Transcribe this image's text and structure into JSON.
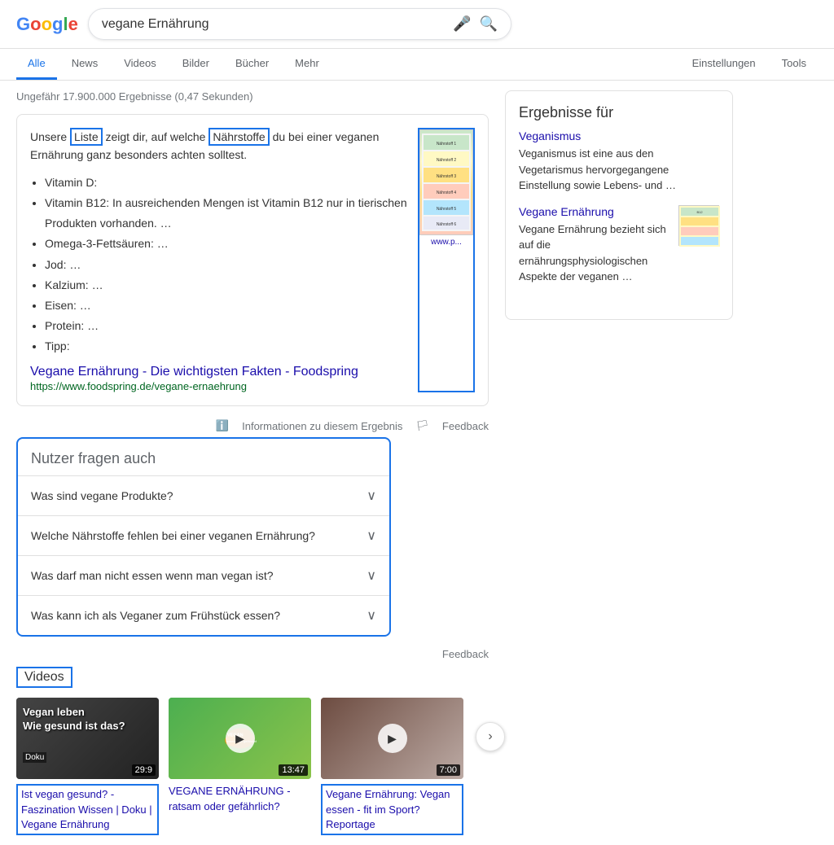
{
  "header": {
    "logo_letters": [
      "G",
      "o",
      "o",
      "g",
      "l",
      "e"
    ],
    "search_query": "vegane Ernährung",
    "mic_icon": "🎤",
    "search_icon": "🔍"
  },
  "nav": {
    "tabs": [
      {
        "label": "Alle",
        "active": true
      },
      {
        "label": "News",
        "active": false
      },
      {
        "label": "Videos",
        "active": false
      },
      {
        "label": "Bilder",
        "active": false
      },
      {
        "label": "Bücher",
        "active": false
      },
      {
        "label": "Mehr",
        "active": false
      }
    ],
    "right_tabs": [
      {
        "label": "Einstellungen"
      },
      {
        "label": "Tools"
      }
    ]
  },
  "results_count": "Ungefähr 17.900.000 Ergebnisse (0,47 Sekunden)",
  "featured_snippet": {
    "text_before": "Unsere ",
    "highlight1": "Liste",
    "text_middle": " zeigt dir, auf welche ",
    "highlight2": "Nährstoffe",
    "text_after": " du bei einer veganen Ernährung ganz besonders achten solltest.",
    "list_items": [
      "Vitamin D:",
      "Vitamin B12: In ausreichenden Mengen ist Vitamin B12 nur in tierischen Produkten vorhanden. …",
      "Omega-3-Fettsäuren: …",
      "Jod: …",
      "Kalzium: …",
      "Eisen: …",
      "Protein: …",
      "Tipp:"
    ],
    "source_title": "Vegane Ernährung - Die wichtigsten Fakten - Foodspring",
    "source_url": "https://www.foodspring.de/vegane-ernaehrung",
    "image_url_text": "www.p..."
  },
  "feedback_row": {
    "info_text": "Informationen zu diesem Ergebnis",
    "feedback_text": "Feedback"
  },
  "paa": {
    "title": "Nutzer fragen auch",
    "items": [
      "Was sind vegane Produkte?",
      "Welche Nährstoffe fehlen bei einer veganen Ernährung?",
      "Was darf man nicht essen wenn man vegan ist?",
      "Was kann ich als Veganer zum Frühstück essen?"
    ],
    "feedback_text": "Feedback"
  },
  "videos_section": {
    "header": "Videos",
    "items": [
      {
        "title_highlighted": true,
        "title": "Ist vegan gesund? - Faszination Wissen | Doku | Vegane Ernährung",
        "duration": "29:9",
        "thumb_label": "Doku",
        "overlay_text": "Vegan leben\nWie gesund ist das?"
      },
      {
        "title_highlighted": false,
        "title": "VEGANE ERNÄHRUNG - ratsam oder gefährlich?",
        "duration": "13:47",
        "thumb_label": "VEGAN"
      },
      {
        "title_highlighted": true,
        "title": "Vegane Ernährung: Vegan essen - fit im Sport? Reportage",
        "duration": "7:00",
        "thumb_label": ""
      }
    ]
  },
  "right_panel": {
    "title": "Ergebnisse für",
    "entries": [
      {
        "link": "Veganismus",
        "description": "Veganismus ist eine aus den Vegetarismus hervorgegangene Einstellung sowie Lebens- und …"
      },
      {
        "link": "Vegane Ernährung",
        "description": "Vegane Ernährung bezieht sich auf die ernährungsphysiologischen Aspekte der veganen …",
        "has_image": true
      }
    ]
  }
}
